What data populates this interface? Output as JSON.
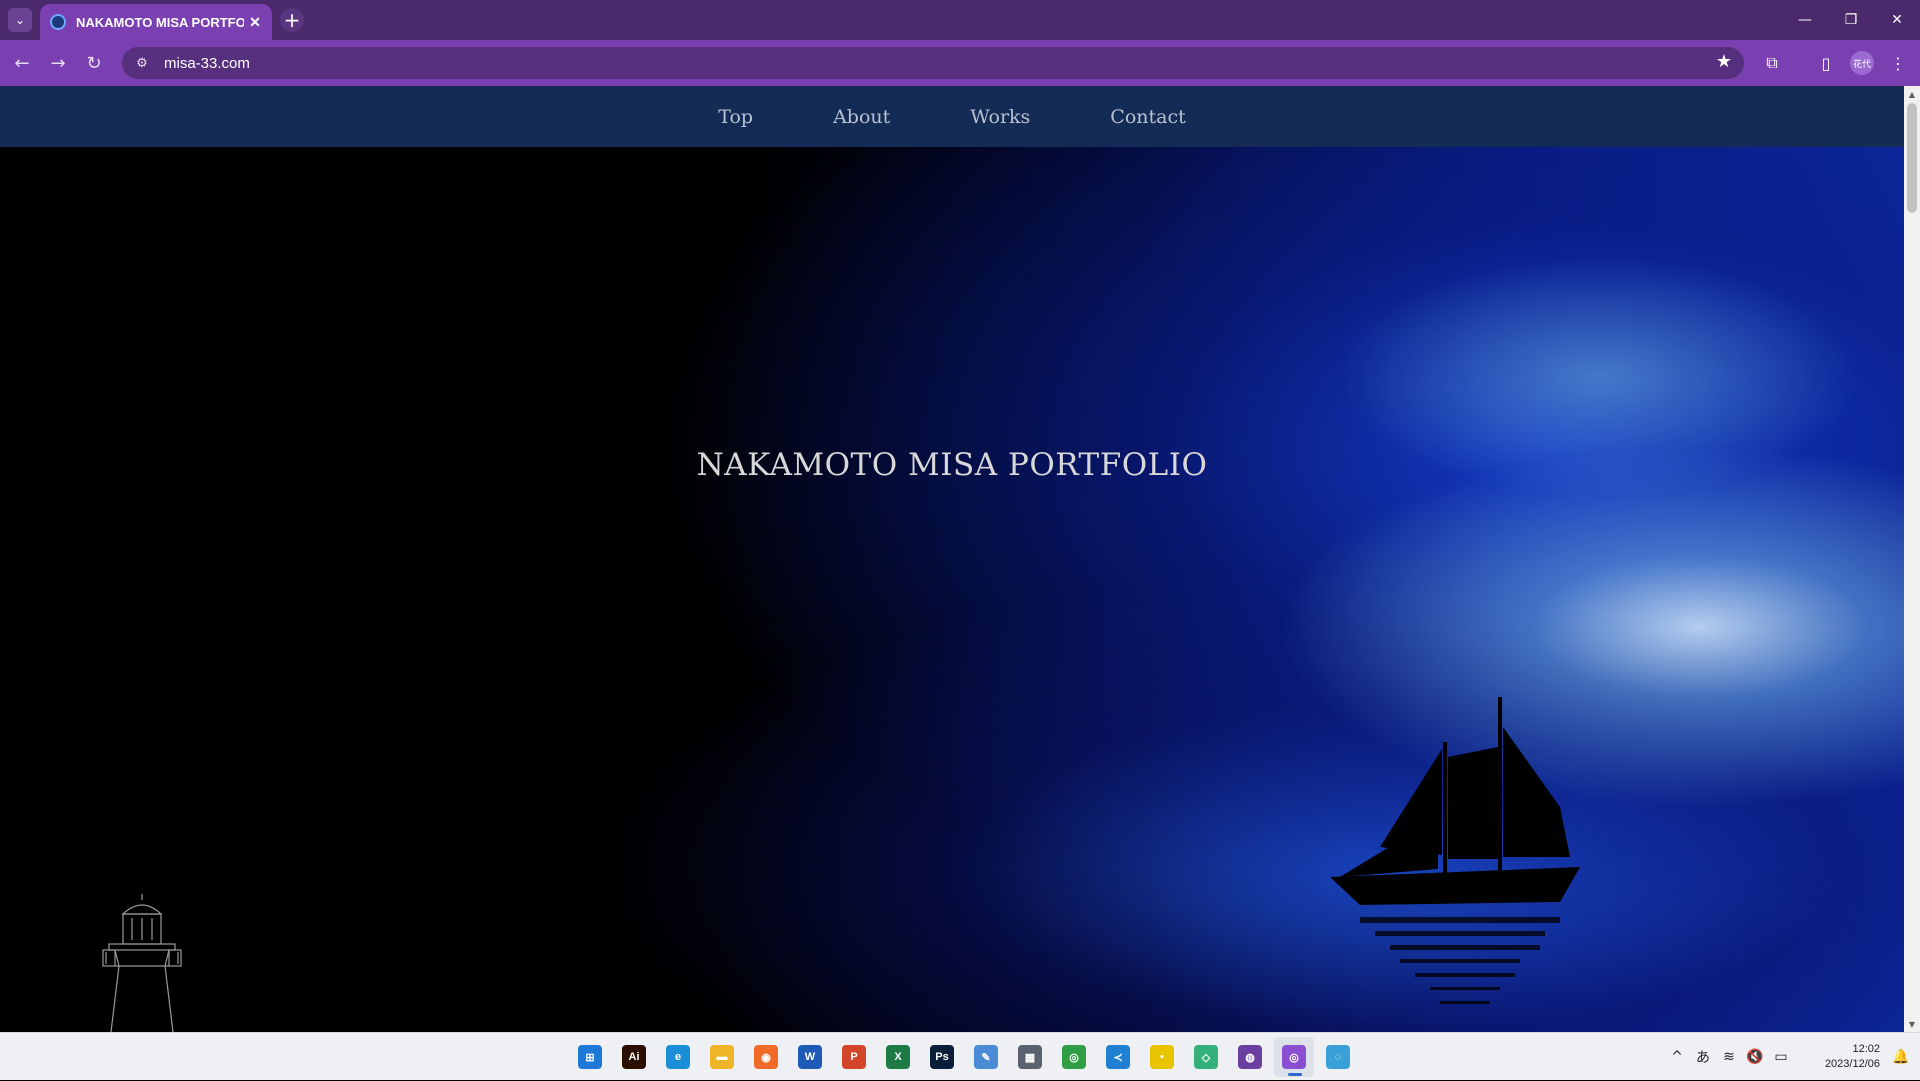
{
  "browser": {
    "tab_title": "NAKAMOTO MISA PORTFOLIO",
    "tab_close": "✕",
    "new_tab": "+",
    "tab_search": "⌄",
    "window_controls": {
      "minimize": "—",
      "restore": "❐",
      "close": "✕"
    },
    "nav": {
      "back": "←",
      "forward": "→",
      "reload": "↻"
    },
    "url": "misa-33.com",
    "site_info_icon": "⚙",
    "bookmark_star": "★",
    "extensions_icon": "⧉",
    "sidebar_icon": "▯",
    "profile_label": "花代",
    "menu_icon": "⋮"
  },
  "site": {
    "nav": [
      "Top",
      "About",
      "Works",
      "Contact"
    ],
    "hero_title": "NAKAMOTO MISA PORTFOLIO"
  },
  "scrollbar": {
    "up": "▲",
    "down": "▼"
  },
  "taskbar": {
    "apps": [
      {
        "name": "windows-start",
        "glyph": "⊞",
        "color": "#1e78d8"
      },
      {
        "name": "illustrator",
        "glyph": "Ai",
        "color": "#2a0e00"
      },
      {
        "name": "edge",
        "glyph": "e",
        "color": "#1a8fd8"
      },
      {
        "name": "file-explorer",
        "glyph": "▬",
        "color": "#f0b428"
      },
      {
        "name": "firefox",
        "glyph": "◉",
        "color": "#f06a28"
      },
      {
        "name": "word",
        "glyph": "W",
        "color": "#1e5bb8"
      },
      {
        "name": "powerpoint",
        "glyph": "P",
        "color": "#d2452a"
      },
      {
        "name": "excel",
        "glyph": "X",
        "color": "#1d7a45"
      },
      {
        "name": "photoshop",
        "glyph": "Ps",
        "color": "#0a1e3a"
      },
      {
        "name": "paint",
        "glyph": "✎",
        "color": "#4a8bd6"
      },
      {
        "name": "calculator",
        "glyph": "▦",
        "color": "#5a6270"
      },
      {
        "name": "chrome",
        "glyph": "◎",
        "color": "#2f9e44"
      },
      {
        "name": "vscode",
        "glyph": "≺",
        "color": "#1f7fd0"
      },
      {
        "name": "sticky-notes",
        "glyph": "▪",
        "color": "#e8c400"
      },
      {
        "name": "app-green",
        "glyph": "◇",
        "color": "#34b07a"
      },
      {
        "name": "github-desktop",
        "glyph": "◍",
        "color": "#6a3fa0"
      },
      {
        "name": "chrome-profile",
        "glyph": "◎",
        "color": "#8a4fd0",
        "active": true
      },
      {
        "name": "app-globe",
        "glyph": "◌",
        "color": "#3aa0d8"
      }
    ],
    "tray": {
      "chevron": "^",
      "ime": "あ",
      "wifi": "≋",
      "volume": "🔇",
      "battery": "▭",
      "time": "12:02",
      "date": "2023/12/06",
      "bell": "🔔"
    }
  }
}
